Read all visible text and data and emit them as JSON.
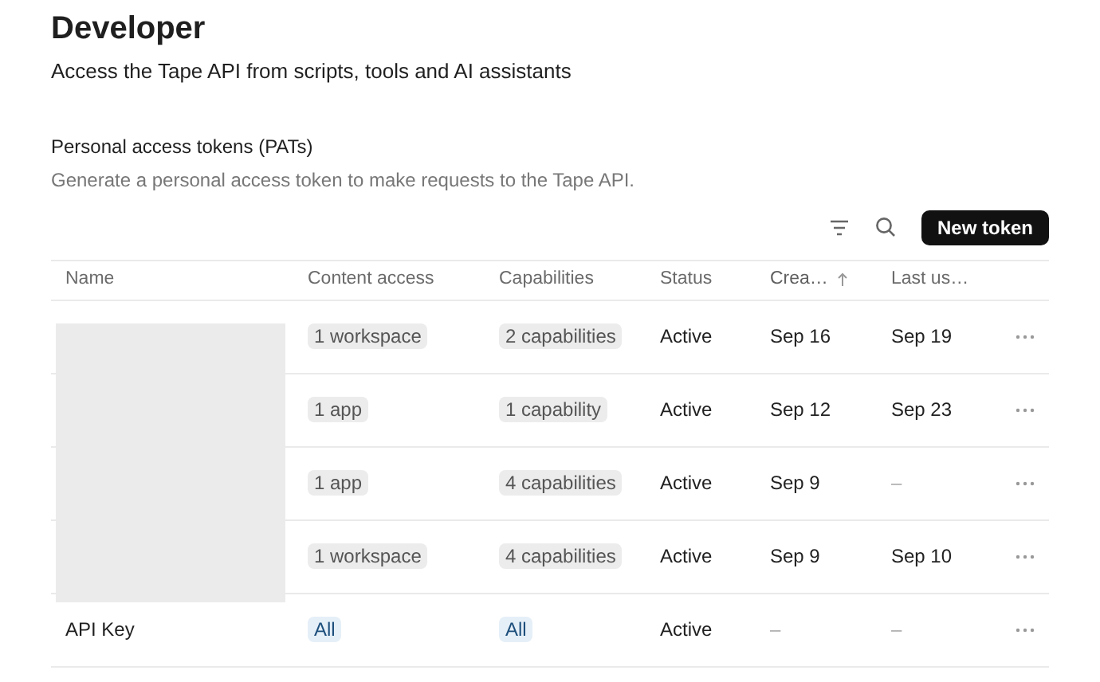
{
  "page": {
    "title": "Developer",
    "subtitle": "Access the Tape API from scripts, tools and AI assistants"
  },
  "section": {
    "title": "Personal access tokens (PATs)",
    "description": "Generate a personal access token to make requests to the Tape API."
  },
  "toolbar": {
    "button": "New token"
  },
  "table": {
    "columns": [
      {
        "label": "Name",
        "sorted": false
      },
      {
        "label": "Content access",
        "sorted": false
      },
      {
        "label": "Capabilities",
        "sorted": false
      },
      {
        "label": "Status",
        "sorted": false
      },
      {
        "label": "Crea…",
        "sorted": true
      },
      {
        "label": "Last us…",
        "sorted": false
      }
    ],
    "rows": [
      {
        "name": null,
        "redacted": true,
        "access": {
          "text": "1 workspace",
          "kind": "neutral"
        },
        "capabilities": {
          "text": "2 capabilities",
          "kind": "neutral"
        },
        "status": "Active",
        "created": "Sep 16",
        "last_used": "Sep 19"
      },
      {
        "name": null,
        "redacted": true,
        "access": {
          "text": "1 app",
          "kind": "neutral"
        },
        "capabilities": {
          "text": "1 capability",
          "kind": "neutral"
        },
        "status": "Active",
        "created": "Sep 12",
        "last_used": "Sep 23"
      },
      {
        "name": null,
        "redacted": true,
        "access": {
          "text": "1 app",
          "kind": "neutral"
        },
        "capabilities": {
          "text": "4 capabilities",
          "kind": "neutral"
        },
        "status": "Active",
        "created": "Sep 9",
        "last_used": "–"
      },
      {
        "name": null,
        "redacted": true,
        "access": {
          "text": "1 workspace",
          "kind": "neutral"
        },
        "capabilities": {
          "text": "4 capabilities",
          "kind": "neutral"
        },
        "status": "Active",
        "created": "Sep 9",
        "last_used": "Sep 10"
      },
      {
        "name": "API Key",
        "redacted": false,
        "access": {
          "text": "All",
          "kind": "accent"
        },
        "capabilities": {
          "text": "All",
          "kind": "accent"
        },
        "status": "Active",
        "created": "–",
        "last_used": "–"
      }
    ]
  }
}
